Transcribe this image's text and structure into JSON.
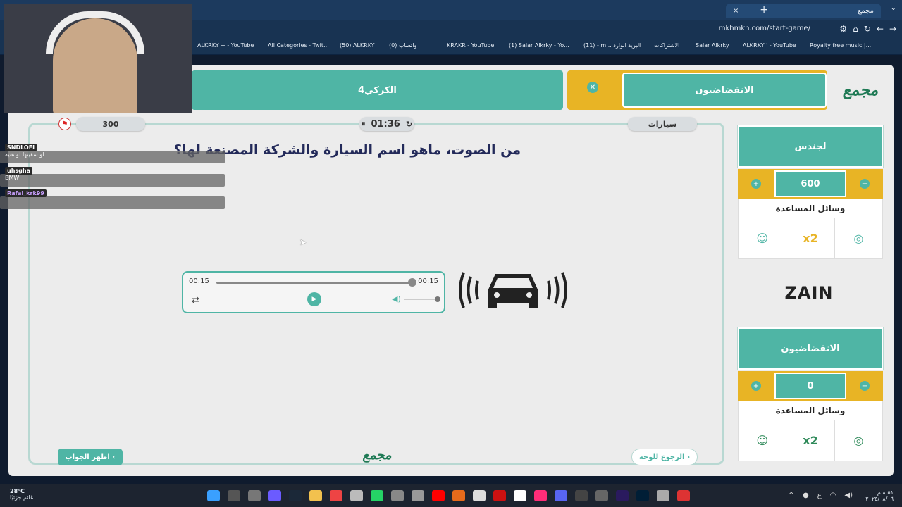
{
  "browser": {
    "tab_title": "مجمع",
    "tab_close": "×",
    "new_tab": "+",
    "url": "mkhmkh.com/start-game/",
    "bookmarks": [
      "ALKRKY + - YouTube",
      "All Categories - Twit...",
      "(50) ALKRKY",
      "(0) واتساب",
      "KRAKR - YouTube",
      "(1) Salar Alkrky - Yo...",
      "(11) - m... البريد الوارد",
      "الاشتراكات",
      "Salar Alkrky",
      "ALKRKY ' - YouTube",
      "Royalty free music |..."
    ]
  },
  "game": {
    "logo": "مجمع",
    "team_left": "الكركي4",
    "team_right": "الانقضاضيون",
    "points": "300",
    "timer": "01:36",
    "category": "سيارات",
    "question": "من الصوت، ماهو اسم السيارة والشركة المصنعة لها؟",
    "audio": {
      "current": "00:15",
      "duration": "00:15",
      "progress": 1.0,
      "volume": 1.0
    },
    "show_answer": "اظهر الجواب",
    "back_to_board": "الرجوع للوحة",
    "sponsor": "ZAIN"
  },
  "side_teams": [
    {
      "name": "لجندس",
      "score": "600",
      "helps_title": "وسائل المساعدة",
      "helps": [
        "x2"
      ]
    },
    {
      "name": "الانقضاضيون",
      "score": "0",
      "helps_title": "وسائل المساعدة",
      "helps": [
        "x2"
      ]
    }
  ],
  "stream_chat": [
    {
      "user": "SNDLOFI",
      "text": "لو سقيتها لو هنية"
    },
    {
      "user": "uhsgha",
      "text": "BMW"
    },
    {
      "user": "Rafal_krk99",
      "text": ""
    }
  ],
  "taskbar": {
    "temperature": "28°C",
    "weather": "غائم جزئيًا",
    "time": "٨:٥١ م",
    "date": "٢٠٢٥/٠٨/٠٦"
  },
  "colors": {
    "teal": "#4fb5a5",
    "gold": "#e8b425",
    "question": "#232a5a"
  }
}
